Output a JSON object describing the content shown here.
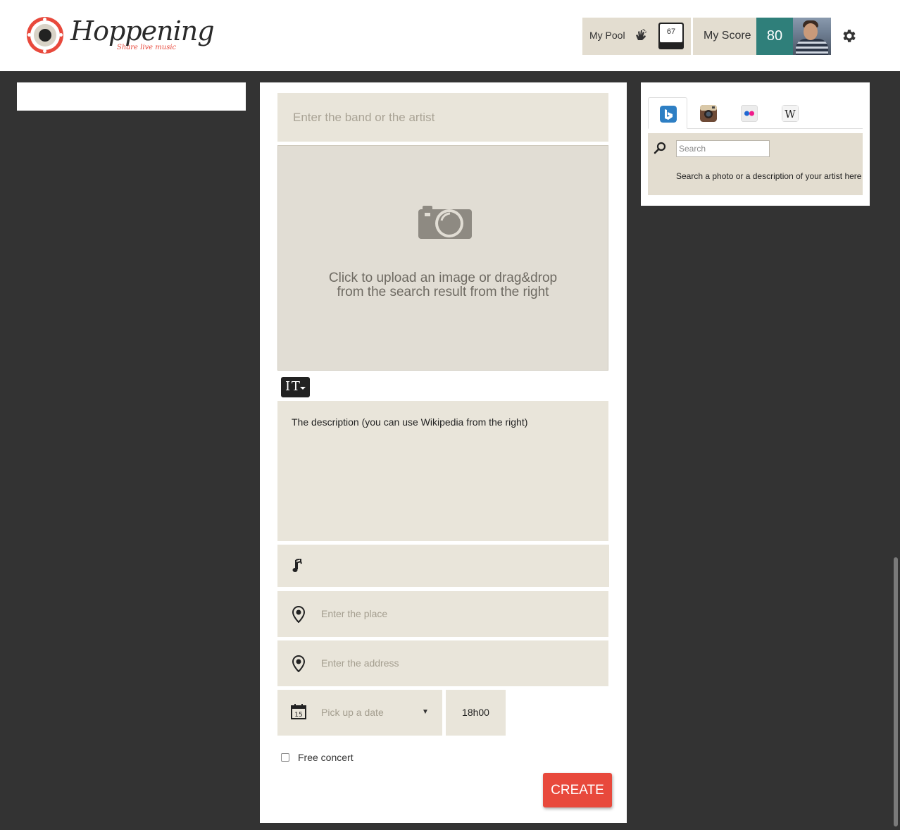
{
  "header": {
    "logo_title": "Hoppening",
    "logo_tagline": "Share live music",
    "pool_label": "My Pool",
    "pool_count": "67",
    "score_label": "My Score",
    "score_value": "80",
    "icons": [
      "clapping-hands-icon",
      "gear-icon",
      "user-avatar"
    ]
  },
  "form": {
    "band_placeholder": "Enter the band or the artist",
    "upload_text_line1": "Click to upload an image or drag&drop",
    "upload_text_line2": "from the search result from the right",
    "description_placeholder": "The description (you can use Wikipedia from the right)",
    "place_placeholder": "Enter the place",
    "address_placeholder": "Enter the address",
    "date_placeholder": "Pick up a date",
    "date_arrow": "▼",
    "time_value": "18h00",
    "calendar_day": "15",
    "free_concert_label": "Free concert",
    "free_concert_checked": false,
    "create_label": "CREATE"
  },
  "search_panel": {
    "tabs": [
      {
        "name": "bing",
        "icon": "bing-icon",
        "active": true
      },
      {
        "name": "instagram",
        "icon": "instagram-icon",
        "active": false
      },
      {
        "name": "flickr",
        "icon": "flickr-icon",
        "active": false
      },
      {
        "name": "wikipedia",
        "icon": "wikipedia-icon",
        "active": false
      }
    ],
    "search_placeholder": "Search",
    "hint": "Search a photo or a description of your artist here"
  },
  "colors": {
    "accent_red": "#e8493c",
    "score_teal": "#2f7f7a",
    "field_beige": "#e9e5da",
    "background_dark": "#333333"
  }
}
